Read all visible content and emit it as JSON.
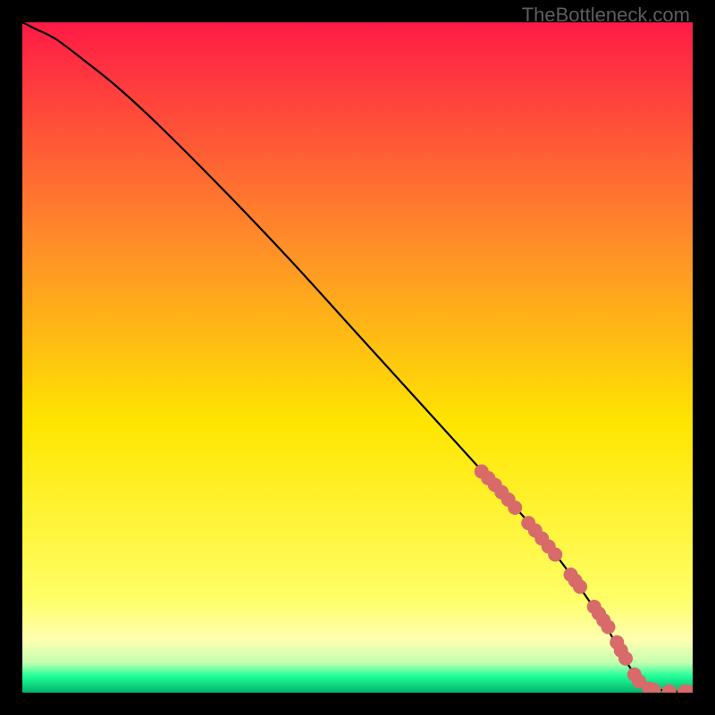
{
  "watermark": "TheBottleneck.com",
  "chart_data": {
    "type": "line",
    "title": "",
    "xlabel": "",
    "ylabel": "",
    "xlim": [
      0,
      100
    ],
    "ylim": [
      0,
      100
    ],
    "grid": false,
    "gradient": {
      "top_color": "#ff1a46",
      "mid_color": "#ffe600",
      "bottom_band_color": "#22ff99",
      "bottom_edge_color": "#00b36b"
    },
    "series": [
      {
        "name": "curve",
        "color": "#000000",
        "x": [
          0,
          2,
          5,
          9,
          14,
          20,
          30,
          40,
          50,
          60,
          70,
          75,
          80,
          84,
          87,
          89,
          90.5,
          92,
          94,
          96,
          98,
          100
        ],
        "y": [
          100,
          99,
          97.5,
          94.5,
          90.5,
          85,
          75,
          64.5,
          53.5,
          42.5,
          31.5,
          26,
          20,
          14.5,
          10,
          6.5,
          4,
          2,
          0.7,
          0.3,
          0.15,
          0.1
        ]
      }
    ],
    "markers": {
      "name": "highlight-segment",
      "color": "#d86a6a",
      "radius_px": 8,
      "x": [
        68.5,
        69.5,
        70.5,
        71.5,
        72.5,
        73.5,
        75.5,
        76.5,
        77.5,
        78.5,
        79.5,
        81.8,
        82.5,
        83.2,
        85.3,
        86.0,
        86.7,
        87.4,
        88.7,
        89.3,
        90,
        91.3,
        92,
        93.5,
        94.2,
        96.5,
        98.8,
        99.4
      ],
      "y": [
        33,
        32,
        31,
        29.9,
        28.8,
        27.6,
        25.3,
        24.2,
        23.0,
        21.8,
        20.6,
        17.6,
        16.7,
        15.8,
        12.8,
        11.8,
        10.8,
        9.8,
        7.5,
        6.3,
        5.1,
        2.7,
        1.7,
        0.6,
        0.4,
        0.2,
        0.15,
        0.12
      ]
    }
  }
}
